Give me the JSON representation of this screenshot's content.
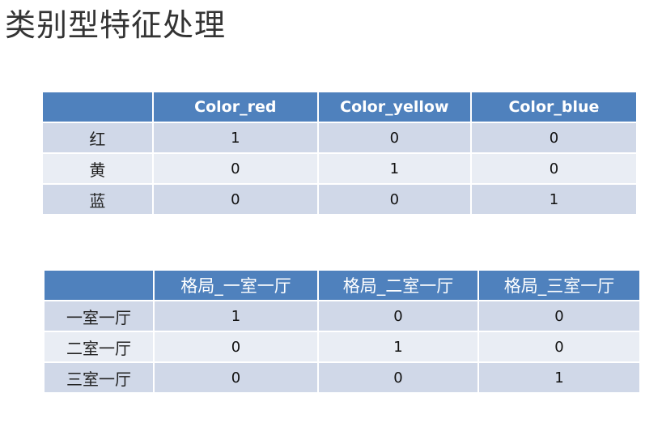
{
  "title": "类别型特征处理",
  "table_color": {
    "headers": [
      "",
      "Color_red",
      "Color_yellow",
      "Color_blue"
    ],
    "rows": [
      {
        "label": "红",
        "values": [
          "1",
          "0",
          "0"
        ]
      },
      {
        "label": "黄",
        "values": [
          "0",
          "1",
          "0"
        ]
      },
      {
        "label": "蓝",
        "values": [
          "0",
          "0",
          "1"
        ]
      }
    ]
  },
  "table_layout": {
    "headers": [
      "",
      "格局_一室一厅",
      "格局_二室一厅",
      "格局_三室一厅"
    ],
    "rows": [
      {
        "label": "一室一厅",
        "values": [
          "1",
          "0",
          "0"
        ]
      },
      {
        "label": "二室一厅",
        "values": [
          "0",
          "1",
          "0"
        ]
      },
      {
        "label": "三室一厅",
        "values": [
          "0",
          "0",
          "1"
        ]
      }
    ]
  },
  "colors": {
    "header_bg": "#4f81bd",
    "row_odd": "#d0d8e8",
    "row_even": "#e9edf4"
  }
}
